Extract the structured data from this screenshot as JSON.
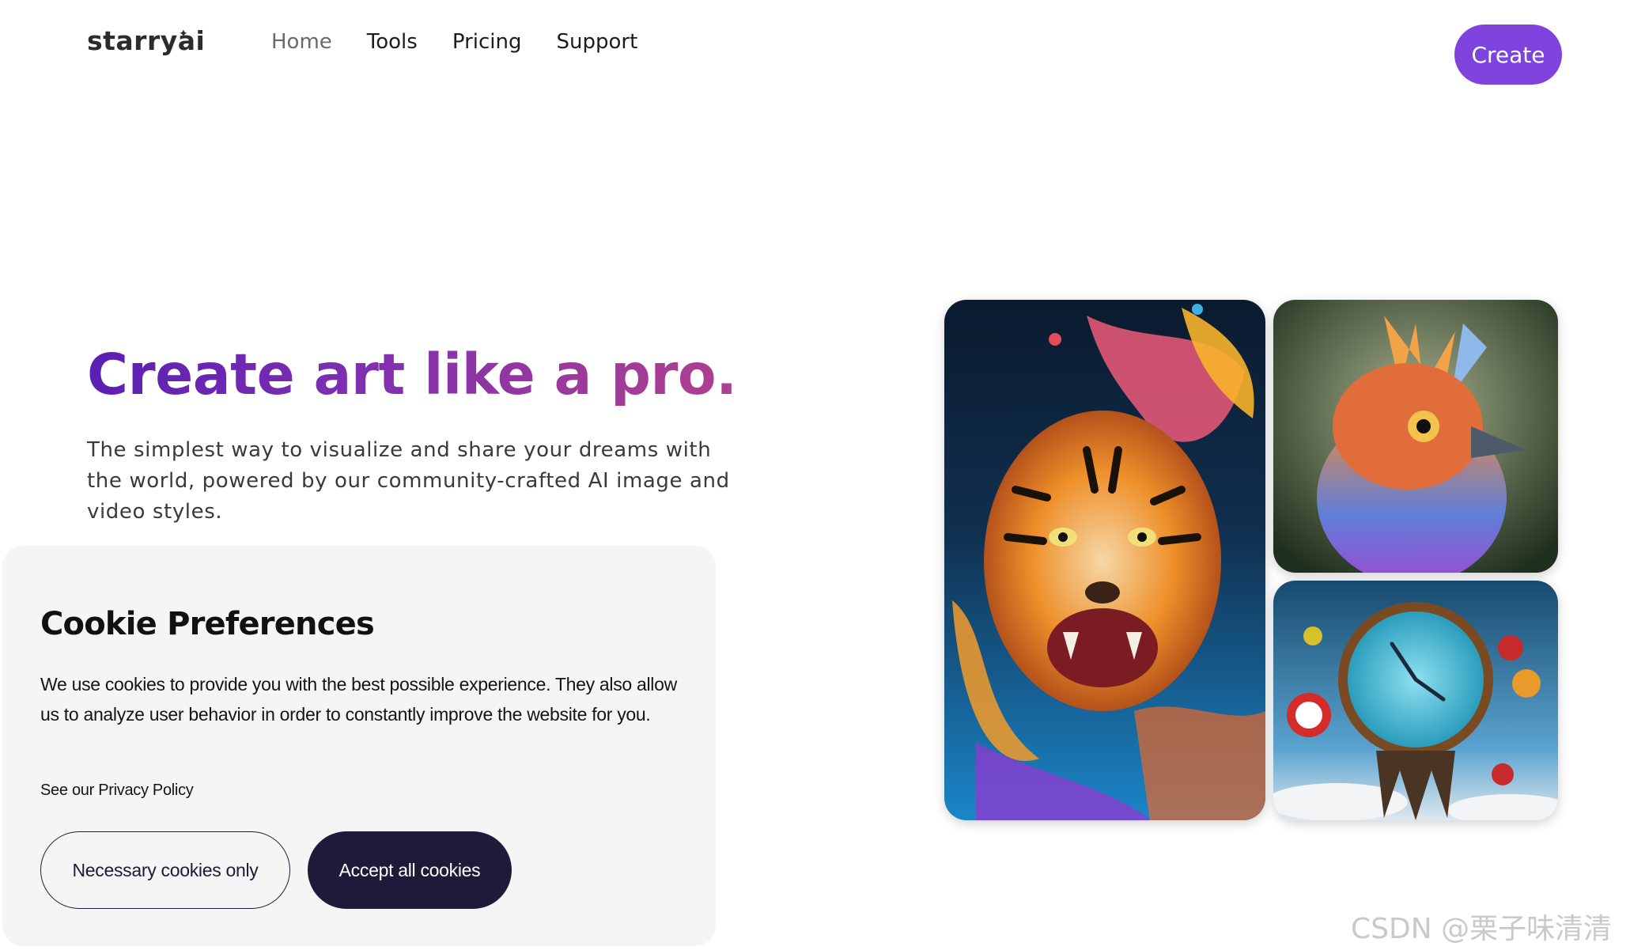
{
  "header": {
    "logo": "starryai",
    "nav": [
      "Home",
      "Tools",
      "Pricing",
      "Support"
    ],
    "create_label": "Create"
  },
  "hero": {
    "title": "Create art like a pro.",
    "subtitle": "The simplest way to visualize and share your dreams with the world, powered by our community-crafted AI image and video styles."
  },
  "gallery": {
    "images": [
      "tiger-artwork",
      "bird-artwork",
      "melting-clock-artwork"
    ]
  },
  "cookie": {
    "title": "Cookie Preferences",
    "text": "We use cookies to provide you with the best possible experience. They also allow us to analyze user behavior in order to constantly improve the website for you.",
    "privacy_link": "See our Privacy Policy",
    "necessary_label": "Necessary cookies only",
    "accept_label": "Accept all cookies"
  },
  "watermark": "CSDN @栗子味清清",
  "colors": {
    "accent": "#7e44dd",
    "title_gradient_start": "#5a1fb3",
    "title_gradient_end": "#b0408f",
    "dark_button": "#1f1a3a",
    "cookie_bg": "#f5f5f5"
  }
}
